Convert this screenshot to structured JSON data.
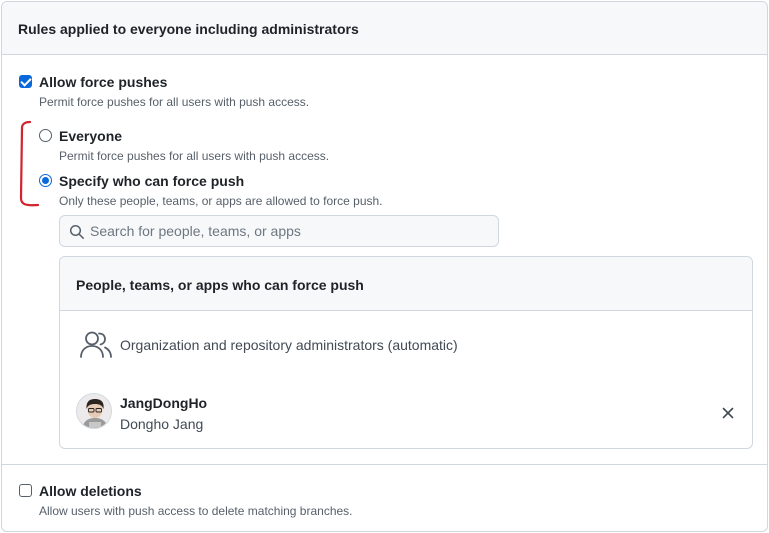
{
  "section": {
    "title": "Rules applied to everyone including administrators"
  },
  "force_push": {
    "label": "Allow force pushes",
    "description": "Permit force pushes for all users with push access.",
    "checked": true,
    "options": [
      {
        "label": "Everyone",
        "description": "Permit force pushes for all users with push access.",
        "selected": false
      },
      {
        "label": "Specify who can force push",
        "description": "Only these people, teams, or apps are allowed to force push.",
        "selected": true
      }
    ],
    "search": {
      "placeholder": "Search for people, teams, or apps",
      "value": ""
    },
    "allowed_list": {
      "title": "People, teams, or apps who can force push",
      "admin_entry": "Organization and repository administrators (automatic)",
      "users": [
        {
          "login": "JangDongHo",
          "name": "Dongho Jang"
        }
      ]
    }
  },
  "deletions": {
    "label": "Allow deletions",
    "description": "Allow users with push access to delete matching branches.",
    "checked": false
  },
  "icons": {
    "search": "search-icon",
    "people": "people-icon",
    "remove": "x-icon"
  },
  "colors": {
    "accent": "#0969da",
    "annotation": "#d1242f",
    "border": "#d0d7de",
    "header_bg": "#f6f8fa",
    "muted_text": "#57606a"
  }
}
